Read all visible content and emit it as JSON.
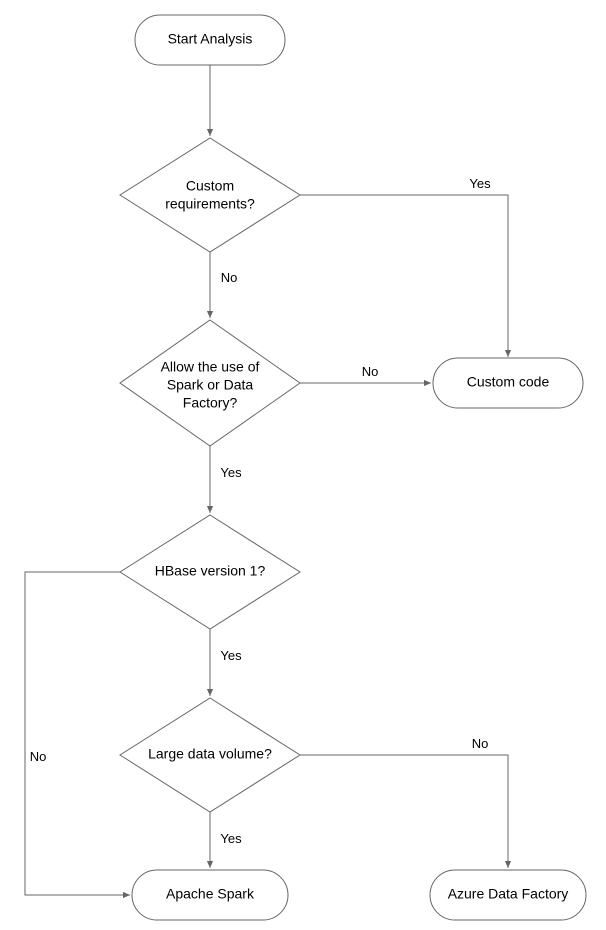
{
  "chart_data": {
    "type": "flowchart",
    "nodes": [
      {
        "id": "start",
        "shape": "terminator",
        "label": "Start Analysis"
      },
      {
        "id": "custom_req",
        "shape": "decision",
        "label": "Custom requirements?"
      },
      {
        "id": "allow_spark",
        "shape": "decision",
        "label": "Allow the use of Spark or Data Factory?"
      },
      {
        "id": "custom_code",
        "shape": "terminator",
        "label": "Custom code"
      },
      {
        "id": "hbase_v1",
        "shape": "decision",
        "label": "HBase version 1?"
      },
      {
        "id": "large_data",
        "shape": "decision",
        "label": "Large data volume?"
      },
      {
        "id": "apache_spark",
        "shape": "terminator",
        "label": "Apache Spark"
      },
      {
        "id": "azure_df",
        "shape": "terminator",
        "label": "Azure Data Factory"
      }
    ],
    "edges": [
      {
        "from": "start",
        "to": "custom_req",
        "label": ""
      },
      {
        "from": "custom_req",
        "to": "custom_code",
        "label": "Yes"
      },
      {
        "from": "custom_req",
        "to": "allow_spark",
        "label": "No"
      },
      {
        "from": "allow_spark",
        "to": "custom_code",
        "label": "No"
      },
      {
        "from": "allow_spark",
        "to": "hbase_v1",
        "label": "Yes"
      },
      {
        "from": "hbase_v1",
        "to": "apache_spark",
        "label": "No"
      },
      {
        "from": "hbase_v1",
        "to": "large_data",
        "label": "Yes"
      },
      {
        "from": "large_data",
        "to": "apache_spark",
        "label": "Yes"
      },
      {
        "from": "large_data",
        "to": "azure_df",
        "label": "No"
      }
    ]
  },
  "labels": {
    "start": "Start Analysis",
    "custom_req_l1": "Custom",
    "custom_req_l2": "requirements?",
    "allow_spark_l1": "Allow the use of",
    "allow_spark_l2": "Spark or Data",
    "allow_spark_l3": "Factory?",
    "custom_code": "Custom code",
    "hbase_v1": "HBase version 1?",
    "large_data": "Large data volume?",
    "apache_spark": "Apache Spark",
    "azure_df": "Azure Data Factory",
    "yes": "Yes",
    "no": "No"
  }
}
